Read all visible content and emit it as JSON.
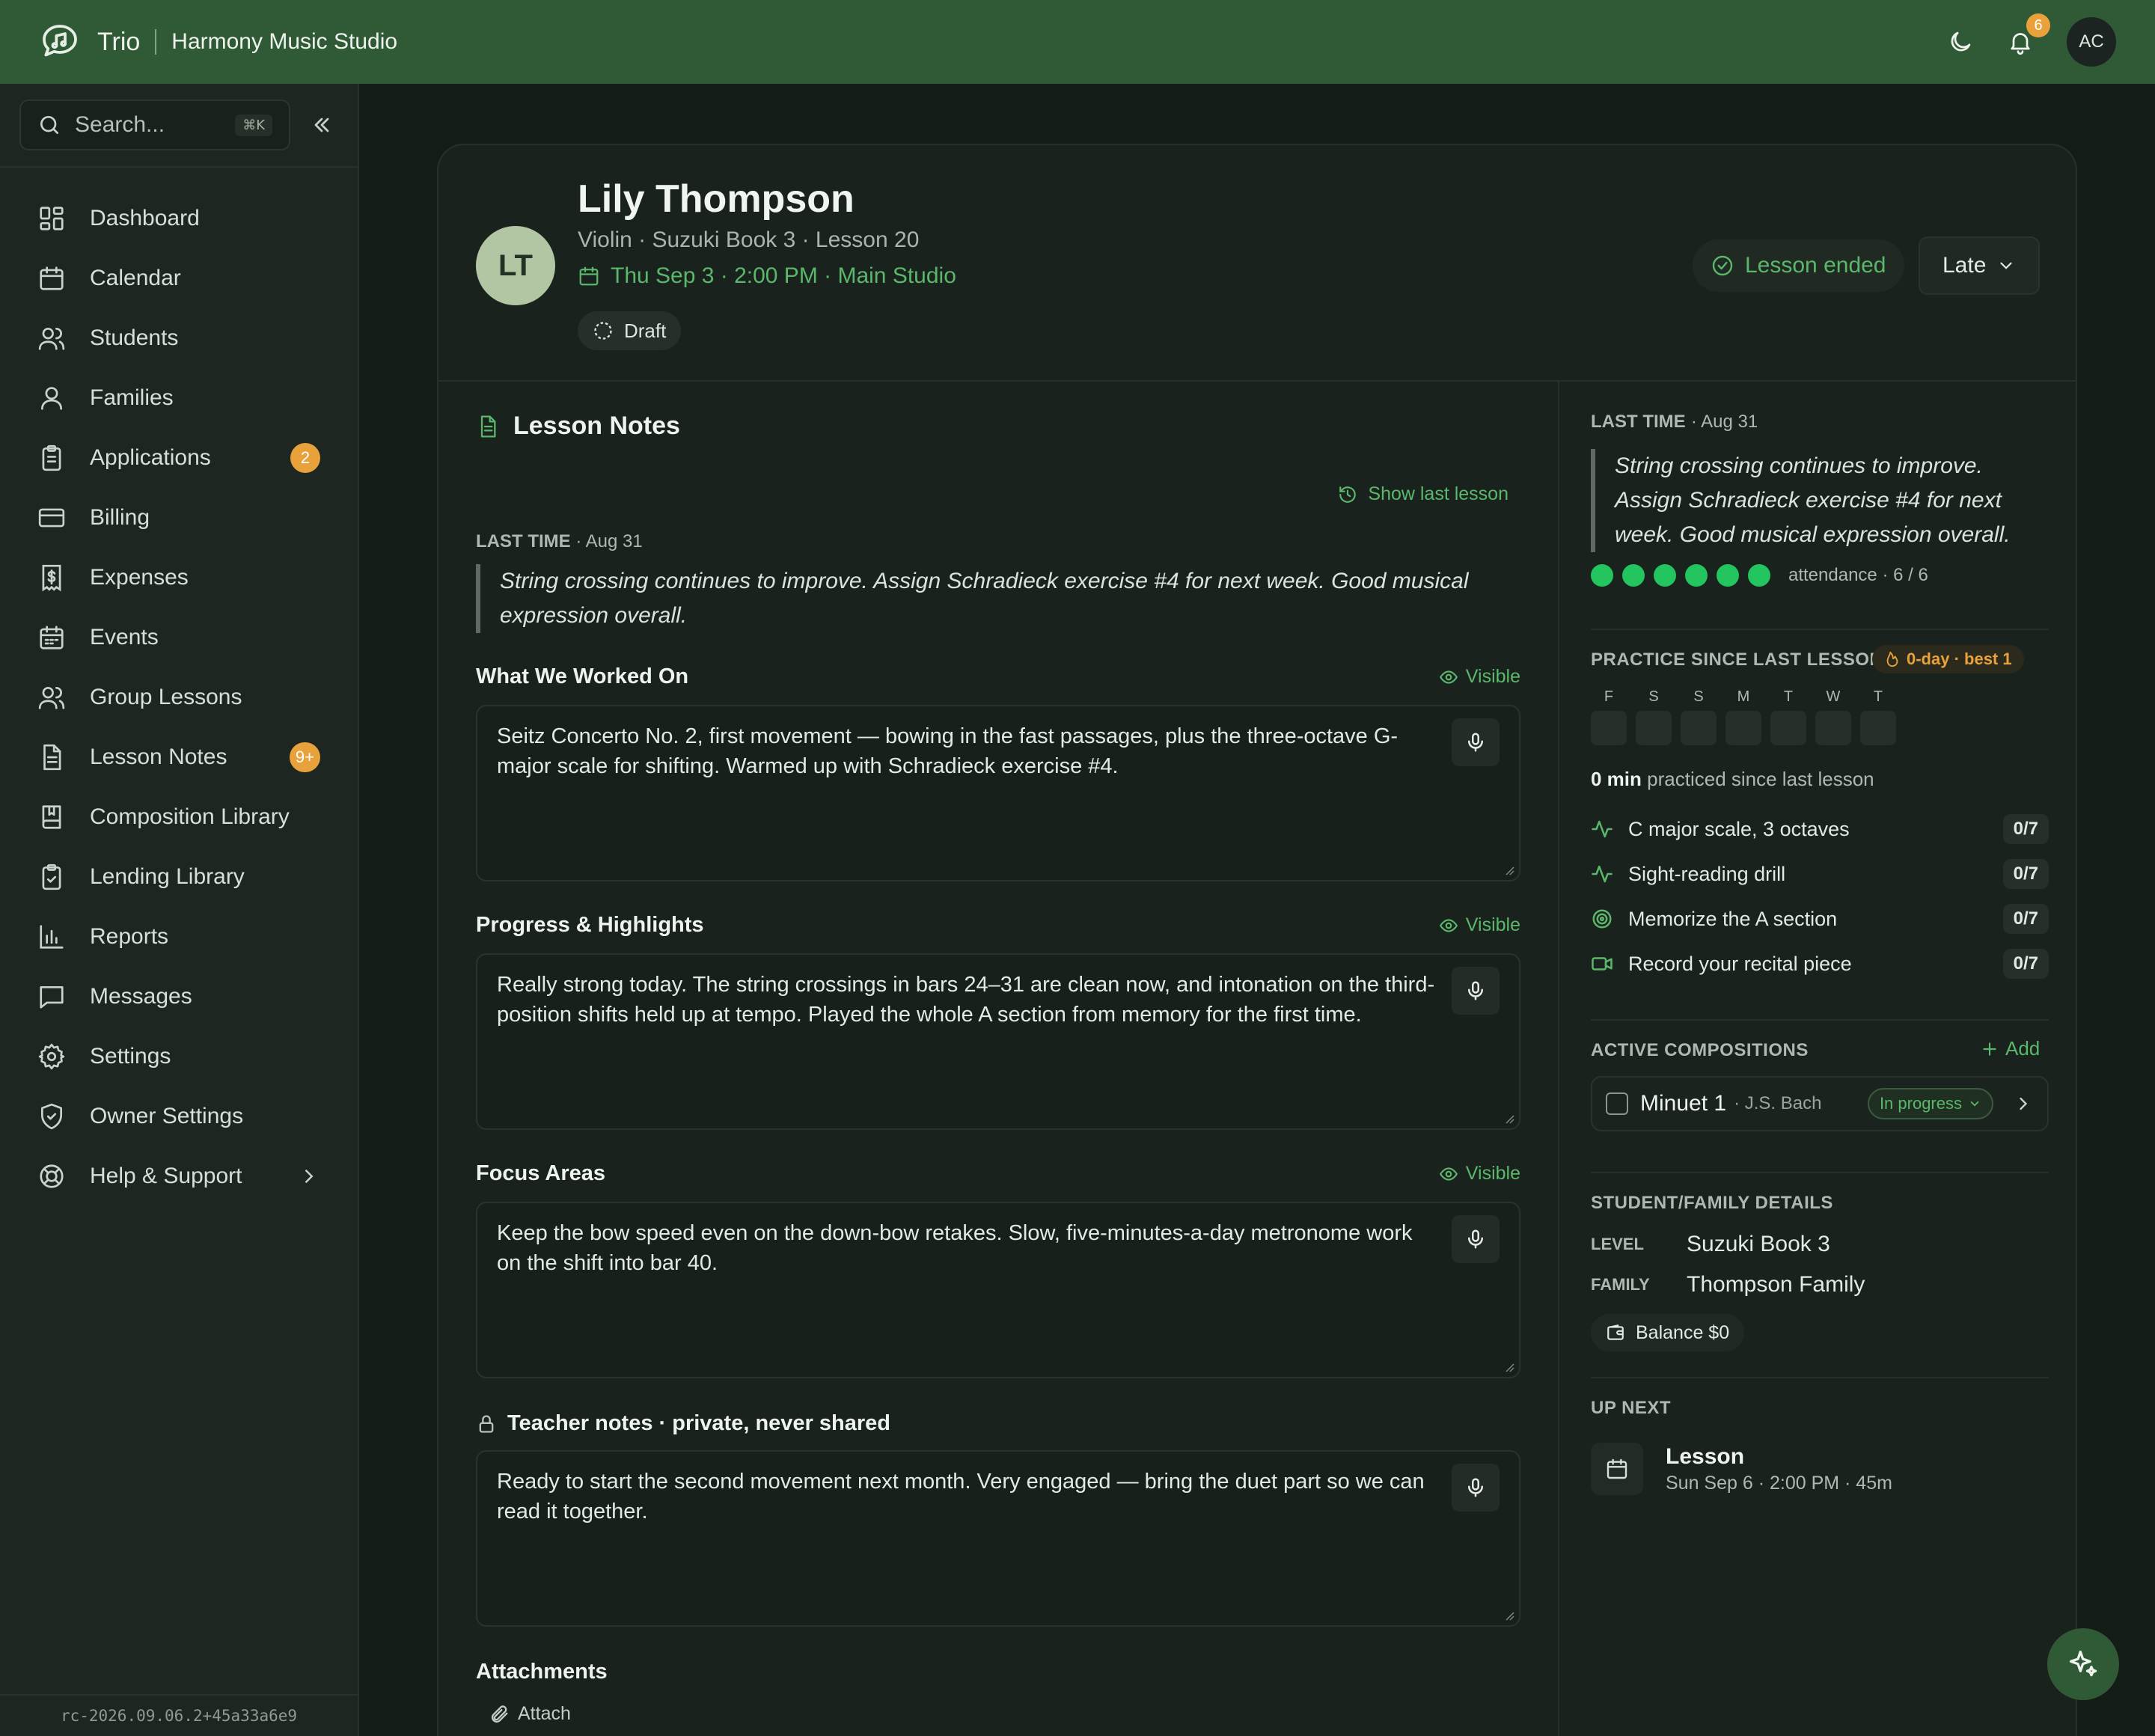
{
  "topbar": {
    "brand": "Trio",
    "studio": "Harmony Music Studio",
    "notification_count": "6",
    "user_initials": "AC",
    "icons": [
      "chat-music-logo-icon",
      "moon-icon",
      "bell-icon"
    ]
  },
  "sidebar": {
    "search_placeholder": "Search...",
    "search_shortcut": "⌘K",
    "items": [
      {
        "label": "Dashboard",
        "icon": "dashboard-icon"
      },
      {
        "label": "Calendar",
        "icon": "calendar-icon"
      },
      {
        "label": "Students",
        "icon": "users-icon"
      },
      {
        "label": "Families",
        "icon": "user-icon"
      },
      {
        "label": "Applications",
        "icon": "clipboard-icon",
        "badge": "2"
      },
      {
        "label": "Billing",
        "icon": "credit-card-icon"
      },
      {
        "label": "Expenses",
        "icon": "receipt-icon"
      },
      {
        "label": "Events",
        "icon": "calendar-grid-icon"
      },
      {
        "label": "Group Lessons",
        "icon": "group-icon"
      },
      {
        "label": "Lesson Notes",
        "icon": "document-icon",
        "badge": "9+"
      },
      {
        "label": "Composition Library",
        "icon": "book-icon"
      },
      {
        "label": "Lending Library",
        "icon": "clipboard-check-icon"
      },
      {
        "label": "Reports",
        "icon": "bar-chart-icon"
      },
      {
        "label": "Messages",
        "icon": "message-icon"
      },
      {
        "label": "Settings",
        "icon": "gear-icon"
      },
      {
        "label": "Owner Settings",
        "icon": "shield-icon"
      },
      {
        "label": "Help & Support",
        "icon": "lifebuoy-icon"
      }
    ],
    "version": "rc-2026.09.06.2+45a33a6e9"
  },
  "lesson": {
    "initials": "LT",
    "student_name": "Lily Thompson",
    "subtitle": "Violin · Suzuki Book 3 · Lesson 20",
    "datetime": "Thu Sep 3 · 2:00 PM · Main Studio",
    "status_draft": "Draft",
    "status_ended": "Lesson ended",
    "attendance_select": "Late"
  },
  "notes": {
    "title": "Lesson Notes",
    "show_last": "Show last lesson",
    "last_time_label": "LAST TIME",
    "last_time_date": "· Aug 31",
    "last_time_text": "String crossing continues to improve. Assign Schradieck exercise #4 for next week. Good musical expression overall.",
    "visible_label": "Visible",
    "fields": [
      {
        "label": "What We Worked On",
        "value": "Seitz Concerto No. 2, first movement — bowing in the fast passages, plus the three-octave G-major scale for shifting. Warmed up with Schradieck exercise #4."
      },
      {
        "label": "Progress & Highlights",
        "value": "Really strong today. The string crossings in bars 24–31 are clean now, and intonation on the third-position shifts held up at tempo. Played the whole A section from memory for the first time."
      },
      {
        "label": "Focus Areas",
        "value": "Keep the bow speed even on the down-bow retakes. Slow, five-minutes-a-day metronome work on the shift into bar 40."
      }
    ],
    "teacher_label": "Teacher notes · private, never shared",
    "teacher_value": "Ready to start the second movement next month. Very engaged — bring the duet part so we can read it together.",
    "attachments_title": "Attachments",
    "attach_label": "Attach"
  },
  "side": {
    "last_time_label": "LAST TIME",
    "last_time_date": "· Aug 31",
    "last_time_text": "String crossing continues to improve. Assign Schradieck exercise #4 for next week. Good musical expression overall.",
    "attendance_label": "attendance · 6 / 6",
    "attendance_present": 6,
    "attendance_total": 6,
    "attendance_color": "#22c55e",
    "practice_title": "PRACTICE SINCE LAST LESSON",
    "streak": "0-day · best 1",
    "days": [
      "F",
      "S",
      "S",
      "M",
      "T",
      "W",
      "T"
    ],
    "practiced_amount": "0 min",
    "practiced_text": "practiced since last lesson",
    "goals": [
      {
        "label": "C major scale, 3 octaves",
        "count": "0/7",
        "icon": "activity-icon"
      },
      {
        "label": "Sight-reading drill",
        "count": "0/7",
        "icon": "activity-icon"
      },
      {
        "label": "Memorize the A section",
        "count": "0/7",
        "icon": "target-icon"
      },
      {
        "label": "Record your recital piece",
        "count": "0/7",
        "icon": "video-icon"
      }
    ],
    "compositions_title": "ACTIVE COMPOSITIONS",
    "add_label": "Add",
    "composition": {
      "name": "Minuet 1",
      "composer": "· J.S. Bach",
      "status": "In progress"
    },
    "details_title": "STUDENT/FAMILY DETAILS",
    "level_key": "LEVEL",
    "level_value": "Suzuki Book 3",
    "family_key": "FAMILY",
    "family_value": "Thompson Family",
    "balance": "Balance $0",
    "upnext_title": "UP NEXT",
    "upnext_name": "Lesson",
    "upnext_when": "Sun Sep 6 · 2:00 PM · 45m"
  },
  "colors": {
    "brand_green": "#2f5a35",
    "accent_green": "#5bb76b",
    "badge_orange": "#e9a23b"
  }
}
